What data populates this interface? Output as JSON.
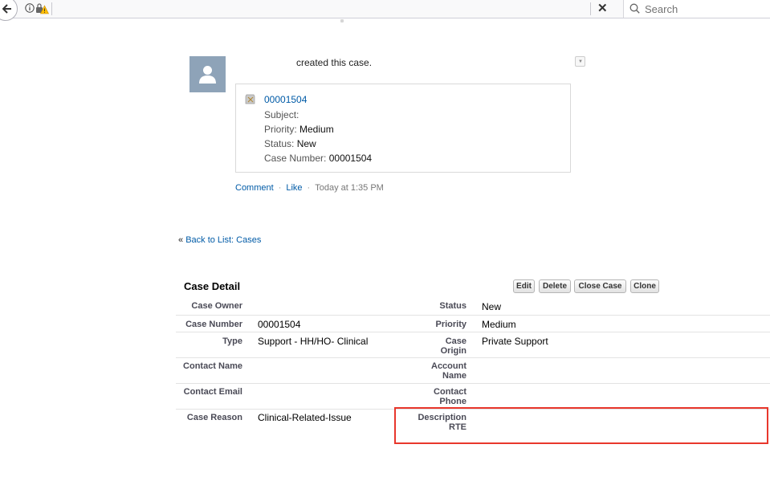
{
  "browser": {
    "search_placeholder": "Search",
    "close_glyph": "✕"
  },
  "feed": {
    "post_text": "created this case.",
    "case": {
      "number_link": "00001504",
      "subject_label": "Subject:",
      "subject_value": "",
      "priority_label": "Priority:",
      "priority_value": "Medium",
      "status_label": "Status:",
      "status_value": "New",
      "case_number_label": "Case Number:",
      "case_number_value": "00001504"
    },
    "actions": {
      "comment": "Comment",
      "like": "Like",
      "separator": "·",
      "timestamp": "Today at 1:35 PM"
    }
  },
  "back_link": {
    "prefix": "«",
    "text": "Back to List: Cases"
  },
  "detail": {
    "title": "Case Detail",
    "buttons": {
      "edit": "Edit",
      "delete": "Delete",
      "close_case": "Close Case",
      "clone": "Clone"
    },
    "left_fields": [
      {
        "label": "Case Owner",
        "value": ""
      },
      {
        "label": "Case Number",
        "value": "00001504"
      },
      {
        "label": "Type",
        "value": "Support - HH/HO- Clinical"
      },
      {
        "label": "Contact Name",
        "value": ""
      },
      {
        "label": "Contact Email",
        "value": ""
      },
      {
        "label": "Case Reason",
        "value": "Clinical-Related-Issue"
      }
    ],
    "right_fields": [
      {
        "label1": "Status",
        "label2": "",
        "value": "New"
      },
      {
        "label1": "Priority",
        "label2": "",
        "value": "Medium"
      },
      {
        "label1": "Case",
        "label2": "Origin",
        "value": "Private Support"
      },
      {
        "label1": "Account",
        "label2": "Name",
        "value": ""
      },
      {
        "label1": "Contact",
        "label2": "Phone",
        "value": ""
      },
      {
        "label1": "Description",
        "label2": "RTE",
        "value": ""
      }
    ]
  },
  "colors": {
    "link": "#015ba7",
    "highlight_border": "#e8372c",
    "avatar_bg": "#8ea3b8"
  }
}
